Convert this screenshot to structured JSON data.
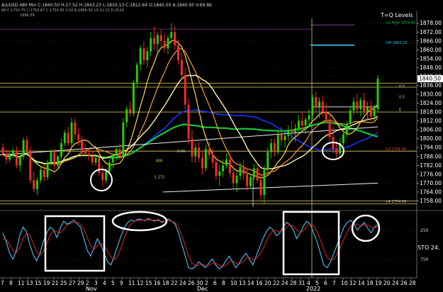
{
  "header": {
    "line1": "AU/USD  480 Min  C:1840.50  H:27.52  H:1843.23  L:1810.13  C:1812.64  O:1840.50  A:1840.95  V:69.8K",
    "line2": "1886.59",
    "line3": "88  C:1750.75  C:1750.87  C:1750.95  V:32  B:1886.59  10-11-21  D:3524"
  },
  "colors": {
    "background": "#000000",
    "grid": "#2a2a2a",
    "candle_up": "#26d000",
    "candle_down": "#ff2b2b",
    "ma_fast": "#ffd84a",
    "ma_mid": "#ff9a3c",
    "ma_blue": "#1c33ff",
    "ma_green": "#12c93a",
    "ma_white": "#f2f2f2",
    "level_line": "#c9b45a",
    "level_magenta": "#a04dbb",
    "cyan_line": "#33ccff",
    "sto_cyan": "#4fc3f7",
    "sto_red": "#d32020",
    "current_price_bg": "#ffffff",
    "current_price_text": "#000000"
  },
  "chart_data": [
    {
      "type": "candlestick",
      "title": "T=Q Levels",
      "ylim": [
        1752,
        1886
      ],
      "y_ticks": [
        "1878.00",
        "1872.00",
        "1866.00",
        "1860.00",
        "1854.00",
        "1848.00",
        "1842.00",
        "1836.00",
        "1830.00",
        "1824.00",
        "1818.00",
        "1812.00",
        "1806.00",
        "1800.00",
        "1794.00",
        "1788.00",
        "1782.00",
        "1776.00",
        "1770.00",
        "1764.00",
        "1758.00"
      ],
      "y_tick_values": [
        1878,
        1872,
        1866,
        1860,
        1854,
        1848,
        1842,
        1836,
        1830,
        1824,
        1818,
        1812,
        1806,
        1800,
        1794,
        1788,
        1782,
        1776,
        1770,
        1764,
        1758
      ],
      "current_price": "1840.50",
      "current_price_value": 1840.5,
      "level_labels": [
        {
          "text": "L0 High 1876.85",
          "value": 1876.8
        },
        {
          "text": "H4 1863.20",
          "value": 1863.2
        },
        {
          "text": "0.0",
          "value": 1834
        },
        {
          "text": "0.5",
          "value": 1826.7
        },
        {
          "text": "E",
          "value": 1818
        },
        {
          "text": "L3 1791.60",
          "value": 1791.6
        },
        {
          "text": "L4 1754.99",
          "value": 1756
        },
        {
          "text": ".000",
          "value": 1783.5
        },
        {
          "text": "1.272",
          "value": 1772.6
        },
        {
          "text": "0.50",
          "value": 1790
        }
      ],
      "horizontal_levels": [
        {
          "value": 1876.8,
          "color": "magenta"
        },
        {
          "value": 1863.2,
          "color": "cyan"
        },
        {
          "value": 1837.5,
          "color": "gold"
        },
        {
          "value": 1834.8,
          "color": "gold"
        },
        {
          "value": 1821.5,
          "color": "white"
        },
        {
          "value": 1818,
          "color": "gold"
        },
        {
          "value": 1791.6,
          "color": "gold"
        },
        {
          "value": 1758,
          "color": "gold"
        },
        {
          "value": 1756,
          "color": "gold"
        }
      ],
      "candles": [
        [
          1794,
          1797,
          1788,
          1790
        ],
        [
          1790,
          1793,
          1783,
          1786
        ],
        [
          1786,
          1791,
          1784,
          1789
        ],
        [
          1789,
          1794,
          1787,
          1792
        ],
        [
          1792,
          1795,
          1780,
          1782
        ],
        [
          1782,
          1790,
          1778,
          1788
        ],
        [
          1788,
          1801,
          1786,
          1799
        ],
        [
          1799,
          1802,
          1790,
          1792
        ],
        [
          1792,
          1795,
          1770,
          1772
        ],
        [
          1772,
          1778,
          1764,
          1766
        ],
        [
          1766,
          1774,
          1762,
          1772
        ],
        [
          1772,
          1781,
          1770,
          1779
        ],
        [
          1779,
          1783,
          1771,
          1774
        ],
        [
          1774,
          1786,
          1772,
          1784
        ],
        [
          1784,
          1793,
          1782,
          1791
        ],
        [
          1791,
          1793,
          1779,
          1782
        ],
        [
          1782,
          1789,
          1780,
          1788
        ],
        [
          1788,
          1800,
          1786,
          1797
        ],
        [
          1797,
          1806,
          1795,
          1804
        ],
        [
          1804,
          1808,
          1795,
          1797
        ],
        [
          1797,
          1814,
          1795,
          1811
        ],
        [
          1811,
          1814,
          1800,
          1803
        ],
        [
          1803,
          1807,
          1795,
          1799
        ],
        [
          1799,
          1802,
          1788,
          1792
        ],
        [
          1792,
          1796,
          1787,
          1790
        ],
        [
          1790,
          1794,
          1785,
          1788
        ],
        [
          1788,
          1792,
          1782,
          1784
        ],
        [
          1784,
          1790,
          1782,
          1787
        ],
        [
          1787,
          1792,
          1775,
          1777
        ],
        [
          1777,
          1782,
          1768,
          1772
        ],
        [
          1772,
          1780,
          1770,
          1778
        ],
        [
          1778,
          1786,
          1776,
          1784
        ],
        [
          1784,
          1790,
          1780,
          1789
        ],
        [
          1789,
          1795,
          1785,
          1793
        ],
        [
          1793,
          1797,
          1786,
          1788
        ],
        [
          1788,
          1814,
          1786,
          1811
        ],
        [
          1811,
          1822,
          1808,
          1820
        ],
        [
          1820,
          1825,
          1815,
          1817
        ],
        [
          1817,
          1840,
          1815,
          1838
        ],
        [
          1838,
          1852,
          1835,
          1850
        ],
        [
          1850,
          1863,
          1846,
          1861
        ],
        [
          1861,
          1866,
          1850,
          1853
        ],
        [
          1853,
          1862,
          1848,
          1859
        ],
        [
          1859,
          1872,
          1856,
          1868
        ],
        [
          1868,
          1876,
          1860,
          1864
        ],
        [
          1864,
          1872,
          1858,
          1870
        ],
        [
          1870,
          1874,
          1862,
          1866
        ],
        [
          1866,
          1871,
          1858,
          1861
        ],
        [
          1861,
          1870,
          1857,
          1868
        ],
        [
          1868,
          1878,
          1864,
          1872
        ],
        [
          1872,
          1876,
          1860,
          1863
        ],
        [
          1863,
          1867,
          1850,
          1853
        ],
        [
          1853,
          1858,
          1840,
          1843
        ],
        [
          1843,
          1848,
          1820,
          1823
        ],
        [
          1823,
          1827,
          1796,
          1800
        ],
        [
          1800,
          1806,
          1784,
          1788
        ],
        [
          1788,
          1797,
          1784,
          1794
        ],
        [
          1794,
          1798,
          1784,
          1787
        ],
        [
          1787,
          1792,
          1776,
          1780
        ],
        [
          1780,
          1796,
          1778,
          1793
        ],
        [
          1793,
          1798,
          1786,
          1789
        ],
        [
          1789,
          1794,
          1780,
          1784
        ],
        [
          1784,
          1788,
          1772,
          1775
        ],
        [
          1775,
          1782,
          1768,
          1778
        ],
        [
          1778,
          1786,
          1774,
          1782
        ],
        [
          1782,
          1790,
          1780,
          1786
        ],
        [
          1786,
          1790,
          1774,
          1777
        ],
        [
          1777,
          1782,
          1766,
          1770
        ],
        [
          1770,
          1778,
          1764,
          1775
        ],
        [
          1775,
          1784,
          1772,
          1781
        ],
        [
          1781,
          1786,
          1772,
          1776
        ],
        [
          1776,
          1780,
          1765,
          1768
        ],
        [
          1768,
          1776,
          1766,
          1774
        ],
        [
          1774,
          1783,
          1772,
          1780
        ],
        [
          1780,
          1784,
          1770,
          1772
        ],
        [
          1772,
          1776,
          1758,
          1762
        ],
        [
          1762,
          1782,
          1756,
          1779
        ],
        [
          1779,
          1794,
          1777,
          1791
        ],
        [
          1791,
          1800,
          1787,
          1797
        ],
        [
          1797,
          1800,
          1788,
          1791
        ],
        [
          1791,
          1806,
          1789,
          1803
        ],
        [
          1803,
          1808,
          1795,
          1799
        ],
        [
          1799,
          1805,
          1794,
          1802
        ],
        [
          1802,
          1809,
          1798,
          1806
        ],
        [
          1806,
          1812,
          1800,
          1804
        ],
        [
          1804,
          1810,
          1798,
          1807
        ],
        [
          1807,
          1816,
          1804,
          1812
        ],
        [
          1812,
          1818,
          1806,
          1809
        ],
        [
          1809,
          1815,
          1803,
          1813
        ],
        [
          1813,
          1820,
          1808,
          1816
        ],
        [
          1816,
          1830,
          1813,
          1828
        ],
        [
          1828,
          1832,
          1818,
          1821
        ],
        [
          1821,
          1828,
          1814,
          1825
        ],
        [
          1825,
          1829,
          1815,
          1818
        ],
        [
          1818,
          1824,
          1810,
          1813
        ],
        [
          1813,
          1817,
          1798,
          1801
        ],
        [
          1801,
          1808,
          1790,
          1793
        ],
        [
          1793,
          1798,
          1786,
          1790
        ],
        [
          1790,
          1800,
          1788,
          1797
        ],
        [
          1797,
          1806,
          1795,
          1803
        ],
        [
          1803,
          1812,
          1801,
          1810
        ],
        [
          1810,
          1822,
          1808,
          1819
        ],
        [
          1819,
          1828,
          1816,
          1825
        ],
        [
          1825,
          1830,
          1817,
          1820
        ],
        [
          1820,
          1828,
          1815,
          1826
        ],
        [
          1826,
          1831,
          1816,
          1818
        ],
        [
          1818,
          1825,
          1812,
          1822
        ],
        [
          1822,
          1826,
          1812,
          1815
        ],
        [
          1815,
          1823,
          1812,
          1820
        ],
        [
          1820,
          1843,
          1818,
          1840.5
        ]
      ]
    },
    {
      "type": "line",
      "title": "STO",
      "value_label": "STO  24.",
      "ylim": [
        0,
        100
      ],
      "y_ticks": [
        "250",
        "750"
      ],
      "series": [
        {
          "color": "cyan",
          "values": [
            70,
            55,
            35,
            25,
            40,
            65,
            80,
            72,
            50,
            32,
            22,
            35,
            55,
            70,
            80,
            75,
            62,
            78,
            90,
            85,
            88,
            92,
            86,
            80,
            60,
            40,
            30,
            45,
            60,
            50,
            35,
            20,
            15,
            30,
            48,
            65,
            80,
            88,
            92,
            90,
            94,
            93,
            91,
            95,
            92,
            90,
            93,
            88,
            90,
            94,
            90,
            85,
            70,
            50,
            30,
            10,
            8,
            12,
            20,
            15,
            10,
            18,
            25,
            15,
            8,
            12,
            22,
            30,
            20,
            10,
            18,
            28,
            35,
            25,
            15,
            30,
            45,
            60,
            72,
            80,
            75,
            65,
            70,
            80,
            88,
            84,
            75,
            60,
            70,
            82,
            90,
            85,
            70,
            55,
            35,
            15,
            10,
            20,
            35,
            50,
            65,
            80,
            88,
            92,
            85,
            75,
            82,
            88,
            78,
            70,
            80,
            84
          ]
        },
        {
          "color": "red",
          "values": [
            60,
            58,
            50,
            40,
            36,
            45,
            60,
            70,
            66,
            52,
            38,
            32,
            38,
            52,
            66,
            74,
            72,
            70,
            76,
            84,
            86,
            88,
            88,
            85,
            76,
            62,
            48,
            42,
            48,
            52,
            48,
            38,
            28,
            24,
            30,
            45,
            62,
            76,
            86,
            90,
            92,
            92,
            92,
            92,
            92,
            92,
            91,
            90,
            90,
            91,
            90,
            88,
            80,
            65,
            48,
            30,
            18,
            14,
            14,
            16,
            14,
            14,
            18,
            18,
            14,
            12,
            14,
            20,
            22,
            18,
            16,
            20,
            26,
            28,
            24,
            26,
            32,
            42,
            55,
            66,
            74,
            74,
            72,
            74,
            80,
            84,
            82,
            75,
            70,
            74,
            82,
            85,
            82,
            72,
            58,
            42,
            28,
            22,
            25,
            34,
            46,
            60,
            72,
            82,
            86,
            84,
            82,
            84,
            83,
            80,
            79,
            80
          ]
        }
      ]
    }
  ],
  "x_axis": {
    "day_labels": [
      "7",
      "8",
      "11",
      "13",
      "15",
      "19",
      "21",
      "25",
      "27",
      "29",
      "2",
      "3",
      "4",
      "5",
      "9",
      "11",
      "12",
      "15",
      "16",
      "18",
      "22",
      "24",
      "26",
      "30",
      "2",
      "6",
      "8",
      "10",
      "13",
      "14",
      "16",
      "20",
      "22",
      "24",
      "28",
      "31",
      "4",
      "5",
      "6",
      "7",
      "10",
      "12",
      "14",
      "18",
      "19",
      "20",
      "24",
      "26",
      "28"
    ],
    "month_labels": [
      {
        "text": "Nov",
        "x": 129
      },
      {
        "text": "Dec",
        "x": 286
      },
      {
        "text": "2022",
        "x": 440
      }
    ]
  }
}
